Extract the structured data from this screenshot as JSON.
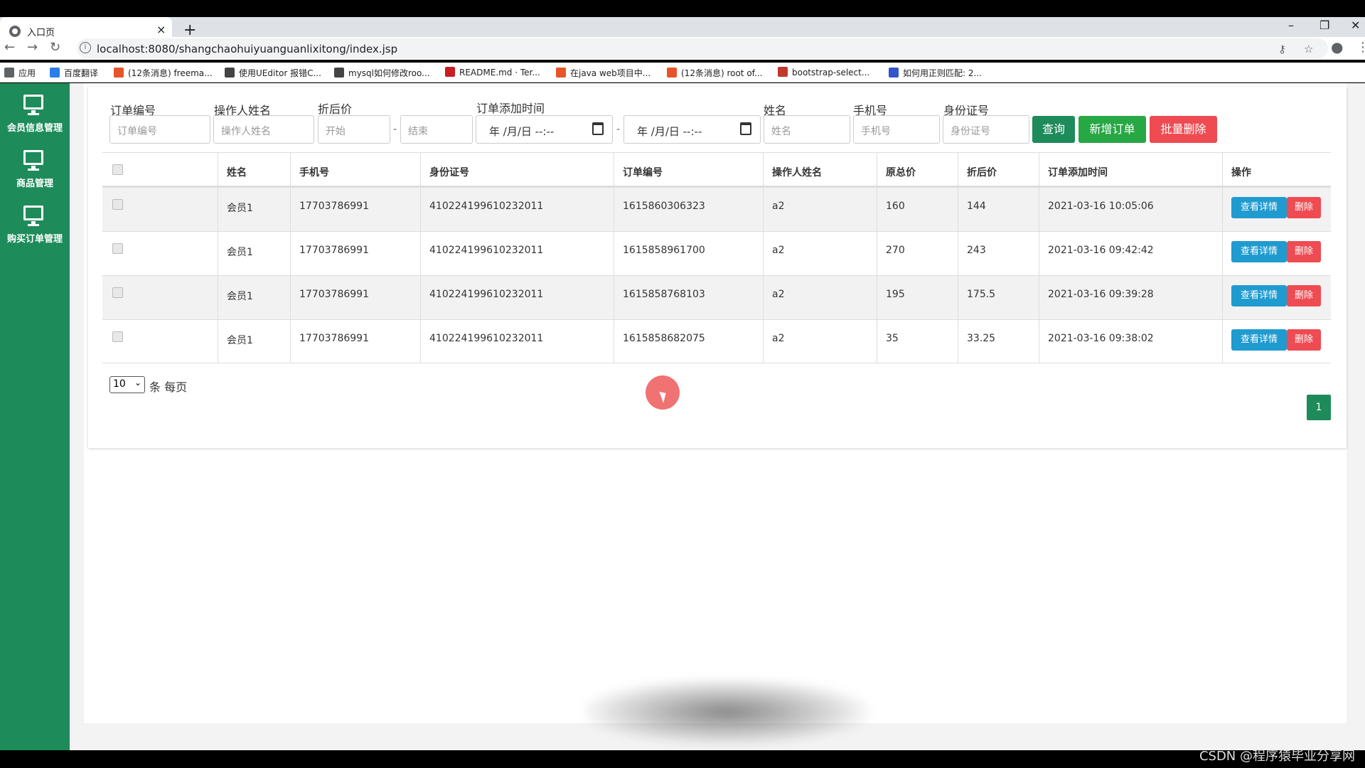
{
  "browser": {
    "tab_title": "入口页",
    "tab_close": "×",
    "new_tab": "+",
    "url": "localhost:8080/shangchaohuiyuanguanlixitong/index.jsp",
    "bookmarks": [
      {
        "label": "应用",
        "color": "#5f6368"
      },
      {
        "label": "百度翻译",
        "color": "#2b7de9"
      },
      {
        "label": "(12条消息) freema...",
        "color": "#e8542a"
      },
      {
        "label": "使用UEditor 报错C...",
        "color": "#444444"
      },
      {
        "label": "mysql如何修改roo...",
        "color": "#444444"
      },
      {
        "label": "README.md · Ter...",
        "color": "#c71d23"
      },
      {
        "label": "在java web项目中...",
        "color": "#e8542a"
      },
      {
        "label": "(12条消息) root of...",
        "color": "#e8542a"
      },
      {
        "label": "bootstrap-select...",
        "color": "#c0392b"
      },
      {
        "label": "如何用正则匹配: 2...",
        "color": "#3355cc"
      }
    ]
  },
  "sidebar": {
    "items": [
      {
        "label": "会员信息管理"
      },
      {
        "label": "商品管理"
      },
      {
        "label": "购买订单管理"
      }
    ]
  },
  "filters": {
    "order_no": {
      "label": "订单编号",
      "placeholder": "订单编号"
    },
    "operator": {
      "label": "操作人姓名",
      "placeholder": "操作人姓名"
    },
    "discount": {
      "label": "折后价",
      "start_placeholder": "开始",
      "end_placeholder": "结束",
      "sep": "-"
    },
    "added_time": {
      "label": "订单添加时间",
      "start": "年 /月/日  --:--",
      "end": "年 /月/日  --:--",
      "sep": "-"
    },
    "name": {
      "label": "姓名",
      "placeholder": "姓名"
    },
    "phone": {
      "label": "手机号",
      "placeholder": "手机号"
    },
    "idcard": {
      "label": "身份证号",
      "placeholder": "身份证号"
    }
  },
  "buttons": {
    "query": "查询",
    "add_order": "新增订单",
    "batch_delete": "批量删除"
  },
  "colors": {
    "sidebar": "#1e8b5a",
    "query": "#1e8b5a",
    "add": "#28a745",
    "delete": "#ef4b52",
    "detail": "#1f9bcf"
  },
  "table": {
    "headers": [
      "姓名",
      "手机号",
      "身份证号",
      "订单编号",
      "操作人姓名",
      "原总价",
      "折后价",
      "订单添加时间",
      "操作"
    ],
    "rows": [
      {
        "name": "会员1",
        "phone": "17703786991",
        "idcard": "410224199610232011",
        "order_no": "1615860306323",
        "operator": "a2",
        "total": "160",
        "discount": "144",
        "time": "2021-03-16 10:05:06"
      },
      {
        "name": "会员1",
        "phone": "17703786991",
        "idcard": "410224199610232011",
        "order_no": "1615858961700",
        "operator": "a2",
        "total": "270",
        "discount": "243",
        "time": "2021-03-16 09:42:42"
      },
      {
        "name": "会员1",
        "phone": "17703786991",
        "idcard": "410224199610232011",
        "order_no": "1615858768103",
        "operator": "a2",
        "total": "195",
        "discount": "175.5",
        "time": "2021-03-16 09:39:28"
      },
      {
        "name": "会员1",
        "phone": "17703786991",
        "idcard": "410224199610232011",
        "order_no": "1615858682075",
        "operator": "a2",
        "total": "35",
        "discount": "33.25",
        "time": "2021-03-16 09:38:02"
      }
    ],
    "action_detail": "查看详情",
    "action_delete": "删除"
  },
  "pagination": {
    "page_size": "10",
    "page_size_label": "条 每页",
    "current_page": "1"
  },
  "watermark": "CSDN @程序猿毕业分享网"
}
